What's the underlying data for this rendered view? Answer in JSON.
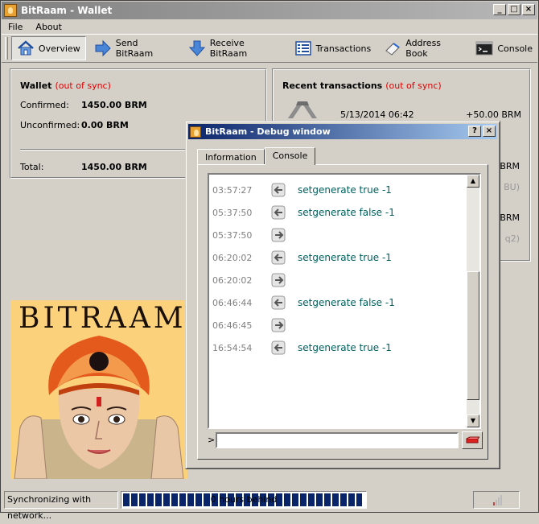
{
  "window": {
    "title": "BitRaam - Wallet",
    "controls": [
      "_",
      "□",
      "×"
    ]
  },
  "menu": [
    {
      "label": "File"
    },
    {
      "label": "About"
    }
  ],
  "toolbar": [
    {
      "label": "Overview",
      "icon": "home-icon",
      "active": true
    },
    {
      "label": "Send BitRaam",
      "icon": "send-arrow-icon"
    },
    {
      "label": "Receive BitRaam",
      "icon": "receive-arrow-icon"
    },
    {
      "label": "Transactions",
      "icon": "list-icon"
    },
    {
      "label": "Address Book",
      "icon": "address-book-icon"
    },
    {
      "label": "Console",
      "icon": "console-icon"
    }
  ],
  "wallet": {
    "title": "Wallet",
    "sync_status": "(out of sync)",
    "confirmed_label": "Confirmed:",
    "confirmed_value": "1450.00 BRM",
    "unconfirmed_label": "Unconfirmed:",
    "unconfirmed_value": "0.00 BRM",
    "total_label": "Total:",
    "total_value": "1450.00 BRM"
  },
  "recent": {
    "title": "Recent transactions",
    "sync_status": "(out of sync)",
    "first_tx": {
      "date": "5/13/2014 06:42",
      "amount": "+50.00 BRM"
    },
    "partial_amounts": [
      "BRM",
      "BRM"
    ],
    "partial_labels": [
      "BU)",
      "q2)"
    ]
  },
  "logo": {
    "text": "BITRAAM"
  },
  "status": {
    "sync_text": "Synchronizing with network...",
    "progress_label": "0 hours behind",
    "progress_fraction": 0.99
  },
  "debug": {
    "title": "BitRaam - Debug window",
    "controls": [
      "?",
      "×"
    ],
    "tabs": [
      {
        "label": "Information"
      },
      {
        "label": "Console",
        "active": true
      }
    ],
    "prompt": ">",
    "input_value": "",
    "lines": [
      {
        "time": "03:57:27",
        "dir": "in",
        "text": "setgenerate true -1"
      },
      {
        "time": "05:37:50",
        "dir": "in",
        "text": "setgenerate false -1"
      },
      {
        "time": "05:37:50",
        "dir": "out",
        "text": ""
      },
      {
        "time": "06:20:02",
        "dir": "in",
        "text": "setgenerate true -1"
      },
      {
        "time": "06:20:02",
        "dir": "out",
        "text": ""
      },
      {
        "time": "06:46:44",
        "dir": "in",
        "text": "setgenerate false -1"
      },
      {
        "time": "06:46:45",
        "dir": "out",
        "text": ""
      },
      {
        "time": "16:54:54",
        "dir": "in",
        "text": "setgenerate true -1"
      }
    ]
  }
}
